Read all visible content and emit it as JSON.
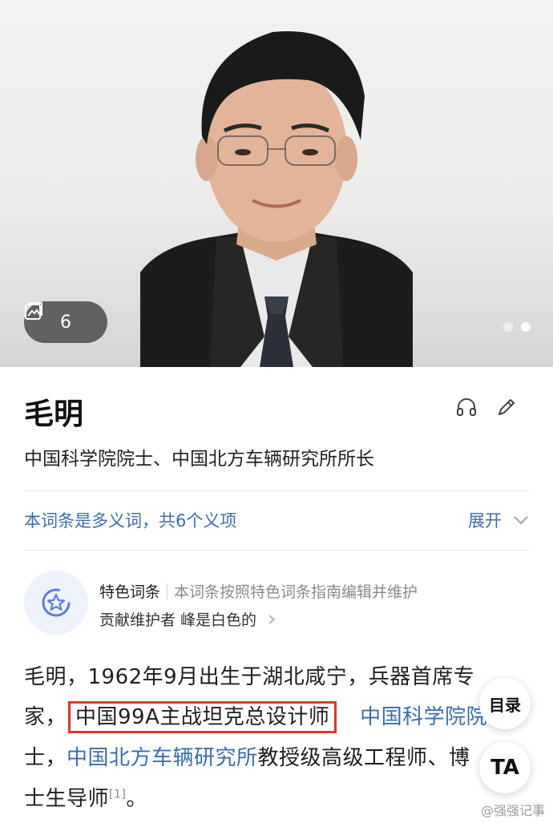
{
  "gallery": {
    "image_count": "6",
    "slides_total": 2,
    "active_slide": 2
  },
  "entry": {
    "title": "毛明",
    "subtitle": "中国科学院院士、中国北方车辆研究所所长"
  },
  "polysemy": {
    "text": "本词条是多义词，共6个义项",
    "expand_label": "展开"
  },
  "featured": {
    "tag": "特色词条",
    "description": "本词条按照特色词条指南编辑并维护",
    "contributor_label": "贡献维护者",
    "contributor_name": "峰是白色的"
  },
  "body": {
    "line1": "毛明，1962年9月出生于湖北咸宁，兵器首席专",
    "line2_prefix": "家，",
    "line2_highlight": "中国99A主战坦克总设计师",
    "line2_link": "中国科学院院",
    "line3_sep": "士，",
    "line3_link": "中国北方车辆研究所",
    "line3_rest": "教授级高级工程师、博",
    "line4_text": "士生导师",
    "line4_ref": "[1]",
    "line4_end": "。"
  },
  "floating": {
    "toc_label": "目录",
    "font_label": "TA"
  },
  "watermark": "@强强记事",
  "colors": {
    "link": "#3b6ea8",
    "highlight_border": "#d93a2b"
  }
}
